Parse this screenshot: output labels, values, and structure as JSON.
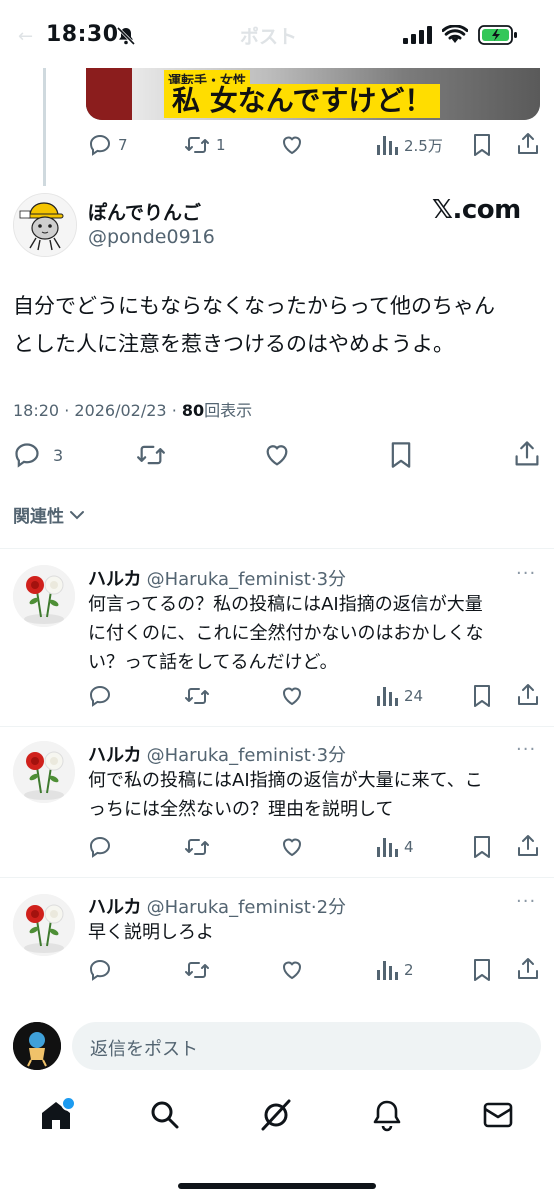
{
  "status_bar": {
    "time": "18:30",
    "battery_color": "#34c759"
  },
  "header": {
    "back_glyph": "←",
    "title": "ポスト"
  },
  "quoted_media": {
    "caption_small": "運転手・女性",
    "caption": "私 女なんですけど！"
  },
  "parent_actions": {
    "replies": "7",
    "reposts": "1",
    "views": "2.5万"
  },
  "post": {
    "author_name": "ぽんでりんご",
    "author_handle": "@ponde0916",
    "source_badge": "𝕏.com",
    "text_line1": "自分でどうにもならなくなったからって他のちゃん",
    "text_line2": "とした人に注意を惹きつけるのはやめようよ。",
    "time": "18:20",
    "sep": "·",
    "date": "2026/02/23",
    "views_count": "80",
    "views_label": "回表示",
    "replies": "3"
  },
  "sort": {
    "label": "関連性"
  },
  "replies": [
    {
      "name": "ハルカ",
      "handle": "@Haruka_feminist",
      "sep": "·",
      "time": "3分",
      "line1": "何言ってるの？私の投稿にはAI指摘の返信が大量",
      "line2": "に付くのに、これに全然付かないのはおかしくな",
      "line3": "い？って話をしてるんだけど。",
      "views": "24",
      "more": "···"
    },
    {
      "name": "ハルカ",
      "handle": "@Haruka_feminist",
      "sep": "·",
      "time": "3分",
      "line1": "何で私の投稿にはAI指摘の返信が大量に来て、こ",
      "line2": "っちには全然ないの？理由を説明して",
      "views": "4",
      "more": "···"
    },
    {
      "name": "ハルカ",
      "handle": "@Haruka_feminist",
      "sep": "·",
      "time": "2分",
      "line1": "早く説明しろよ",
      "views": "2",
      "more": "···"
    }
  ],
  "composer": {
    "placeholder": "返信をポスト"
  },
  "tab_bar": {
    "items": [
      "home-icon",
      "search-icon",
      "grok-icon",
      "notifications-icon",
      "messages-icon"
    ],
    "notification_dot_color": "#1d9bf0"
  }
}
